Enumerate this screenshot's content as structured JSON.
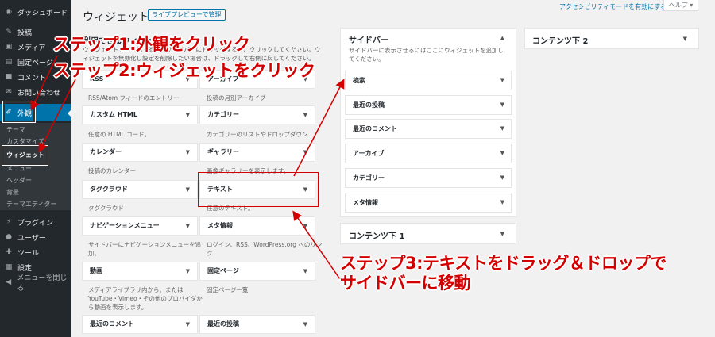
{
  "sidebar": {
    "dashboard": "ダッシュボード",
    "posts": "投稿",
    "media": "メディア",
    "pages": "固定ページ",
    "comments": "コメント",
    "contact": "お問い合わせ",
    "appearance": "外観",
    "sub": {
      "themes": "テーマ",
      "customize": "カスタマイズ",
      "widgets": "ウィジェット",
      "menus": "メニュー",
      "header": "ヘッダー",
      "background": "背景",
      "editor": "テーマエディター"
    },
    "plugins": "プラグイン",
    "users": "ユーザー",
    "tools": "ツール",
    "settings": "設定",
    "collapse": "メニューを閉じる"
  },
  "header": {
    "title": "ウィジェット",
    "manage_btn": "ライブプレビューで管理",
    "accessibility": "アクセシビリティモードを有効にする",
    "help": "ヘルプ ▾"
  },
  "available": {
    "title": "利用できるウィジェット",
    "desc": "ウィジェットを有効化するにはサイドバーにドラッグするか、クリックしてください。ウィジェットを無効化し設定を削除したい場合は、ドラッグして右側に戻してください。",
    "widgets": [
      {
        "name": "RSS",
        "desc": "RSS/Atom フィードのエントリー"
      },
      {
        "name": "アーカイブ",
        "desc": "投稿の月別アーカイブ"
      },
      {
        "name": "カスタム HTML",
        "desc": "任意の HTML コード。"
      },
      {
        "name": "カテゴリー",
        "desc": "カテゴリーのリストやドロップダウン"
      },
      {
        "name": "カレンダー",
        "desc": "投稿のカレンダー"
      },
      {
        "name": "ギャラリー",
        "desc": "画像ギャラリーを表示します。"
      },
      {
        "name": "タグクラウド",
        "desc": "タグクラウド"
      },
      {
        "name": "テキスト",
        "desc": "任意のテキスト。"
      },
      {
        "name": "ナビゲーションメニュー",
        "desc": "サイドバーにナビゲーションメニューを追加。"
      },
      {
        "name": "メタ情報",
        "desc": "ログイン、RSS、WordPress.org へのリンク"
      },
      {
        "name": "動画",
        "desc": "メディアライブラリ内から、または YouTube・Vimeo・その他のプロバイダから動画を表示します。"
      },
      {
        "name": "固定ページ",
        "desc": "固定ページ一覧"
      },
      {
        "name": "最近のコメント",
        "desc": ""
      },
      {
        "name": "最近の投稿",
        "desc": ""
      }
    ]
  },
  "sidebar_area": {
    "title": "サイドバー",
    "desc": "サイドバーに表示させるにはここにウィジェットを追加してください。",
    "widgets": [
      "検索",
      "最近の投稿",
      "最近のコメント",
      "アーカイブ",
      "カテゴリー",
      "メタ情報"
    ]
  },
  "content_bottom_1": {
    "title": "コンテンツ下 1"
  },
  "content_bottom_2": {
    "title": "コンテンツ下 2"
  },
  "annotations": {
    "step1": "ステップ1:外観をクリック",
    "step2": "ステップ2:ウィジェットをクリック",
    "step3_line1": "ステップ3:テキストをドラッグ＆ドロップで",
    "step3_line2": "サイドバーに移動"
  },
  "colors": {
    "accent": "#0073aa",
    "sidebar": "#23282d",
    "annotation": "#d40000"
  }
}
